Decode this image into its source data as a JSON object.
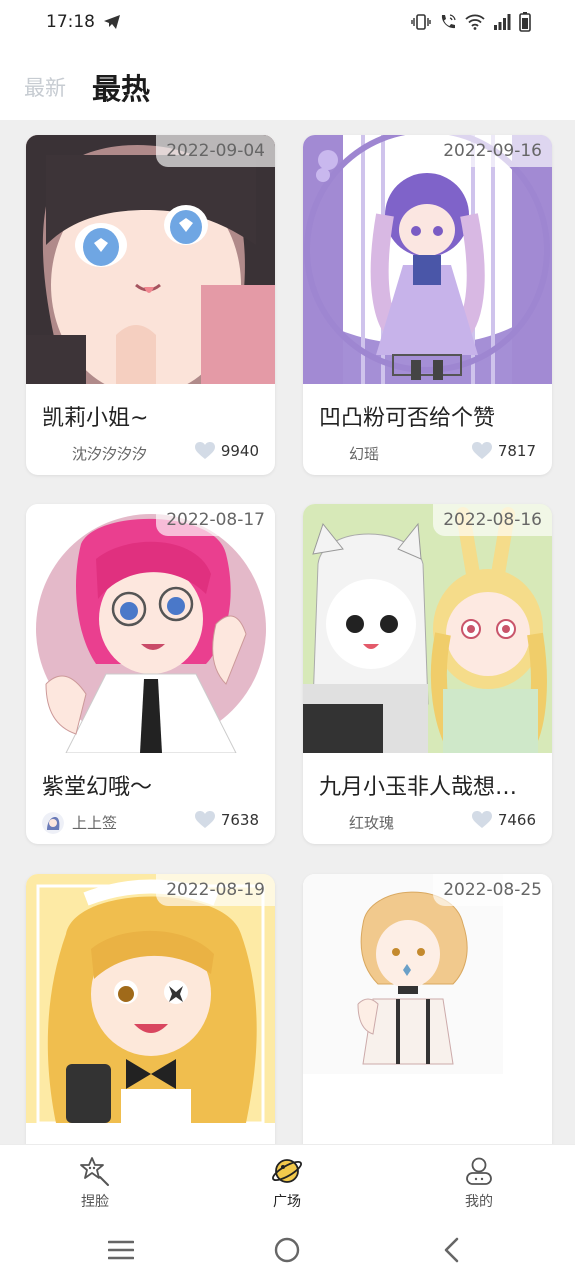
{
  "status_bar": {
    "time": "17:18",
    "icons": [
      "telegram-send-icon",
      "vibrate-icon",
      "wifi-calling-icon",
      "wifi-icon",
      "signal-icon",
      "battery-icon"
    ]
  },
  "header": {
    "tabs": [
      {
        "label": "最新",
        "active": false
      },
      {
        "label": "最热",
        "active": true
      }
    ]
  },
  "feed": {
    "cards": [
      {
        "date": "2022-09-04",
        "title": "凯莉小姐~",
        "author": "沈汐汐汐汐",
        "likes": "9940",
        "image": "anime-girl-dark-hair-illustration"
      },
      {
        "date": "2022-09-16",
        "title": "凹凸粉可否给个赞",
        "author": "幻瑶",
        "likes": "7817",
        "image": "anime-girl-purple-dress-illustration"
      },
      {
        "date": "2022-08-17",
        "title": "紫堂幻哦～",
        "author": "上上签",
        "likes": "7638",
        "image": "anime-pink-hair-glasses-illustration"
      },
      {
        "date": "2022-08-16",
        "title": "九月小玉非人哉想…",
        "author": "红玫瑰",
        "likes": "7466",
        "image": "anime-two-girls-illustration"
      },
      {
        "date": "2022-08-19",
        "title": "",
        "author": "",
        "likes": "",
        "image": "anime-blonde-maid-illustration"
      },
      {
        "date": "2022-08-25",
        "title": "",
        "author": "",
        "likes": "",
        "image": "anime-sketch-boy-illustration"
      }
    ]
  },
  "bottom_nav": {
    "items": [
      {
        "label": "捏脸",
        "icon": "face-star-icon",
        "active": false
      },
      {
        "label": "广场",
        "icon": "planet-icon",
        "active": true
      },
      {
        "label": "我的",
        "icon": "user-icon",
        "active": false
      }
    ]
  },
  "system_nav": {
    "icons": [
      "menu-icon",
      "home-icon",
      "back-icon"
    ]
  },
  "colors": {
    "accent": "#f2c94c",
    "heart": "#d3dbe6",
    "inactive_tab": "#c7ccd2"
  }
}
